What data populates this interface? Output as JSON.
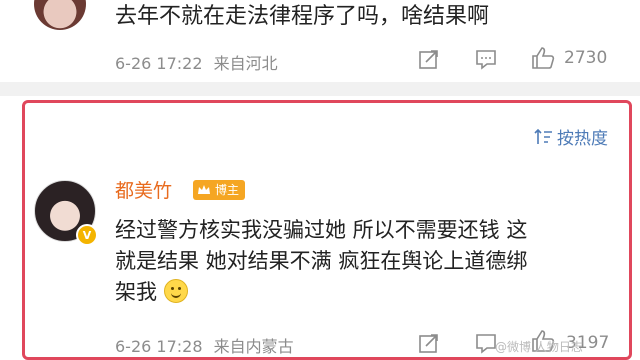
{
  "comment1": {
    "text": "去年不就在走法律程序了吗，啥结果啊",
    "time": "6-26 17:22",
    "location": "来自河北",
    "likes": "2730"
  },
  "sort": {
    "label": "按热度"
  },
  "comment2": {
    "username": "都美竹",
    "badge": "博主",
    "text_part1": "经过警方核实我没骗过她 所以不需要还钱 这",
    "text_part2": "就是结果 她对结果不满 疯狂在舆论上道德绑",
    "text_part3": "架我",
    "time": "6-26 17:28",
    "location": "来自内蒙古",
    "likes": "3197"
  },
  "watermark": "@微博 人物日志",
  "colors": {
    "highlight": "#e0475c",
    "username": "#e86b1f",
    "badge": "#f5a623",
    "link": "#4e7bb7"
  },
  "icons": [
    "share-icon",
    "comment-icon",
    "like-icon",
    "sort-icon",
    "crown-icon",
    "smile-emoji"
  ]
}
